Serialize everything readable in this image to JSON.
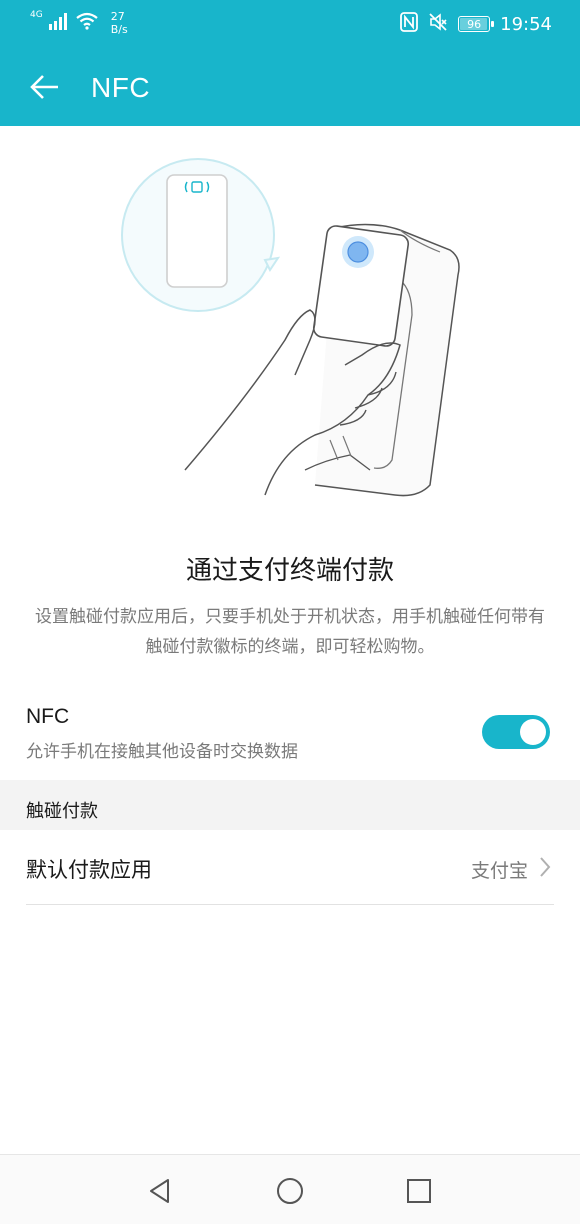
{
  "status_bar": {
    "network": "4G",
    "speed_value": "27",
    "speed_unit": "B/s",
    "battery": "96",
    "battery_level": 0.96,
    "time": "19:54",
    "icons": [
      "signal-icon",
      "wifi-icon",
      "nfc-status-icon",
      "mute-icon",
      "battery-icon"
    ]
  },
  "app_bar": {
    "title": "NFC",
    "back_icon": "arrow-left-icon"
  },
  "intro": {
    "heading": "通过支付终端付款",
    "description": "设置触碰付款应用后，只要手机处于开机状态，用手机触碰任何带有触碰付款徽标的终端，即可轻松购物。"
  },
  "nfc_setting": {
    "title": "NFC",
    "subtitle": "允许手机在接触其他设备时交换数据",
    "enabled": true
  },
  "tap_payment": {
    "header": "触碰付款",
    "default_app_label": "默认付款应用",
    "default_app_value": "支付宝"
  },
  "nav_bar": {
    "icons": [
      "back-triangle-icon",
      "home-circle-icon",
      "recents-square-icon"
    ]
  },
  "colors": {
    "accent": "#18b5cb",
    "text_primary": "#1a1a1a",
    "text_secondary": "#7a7a7a",
    "group_bg": "#f3f3f3"
  }
}
